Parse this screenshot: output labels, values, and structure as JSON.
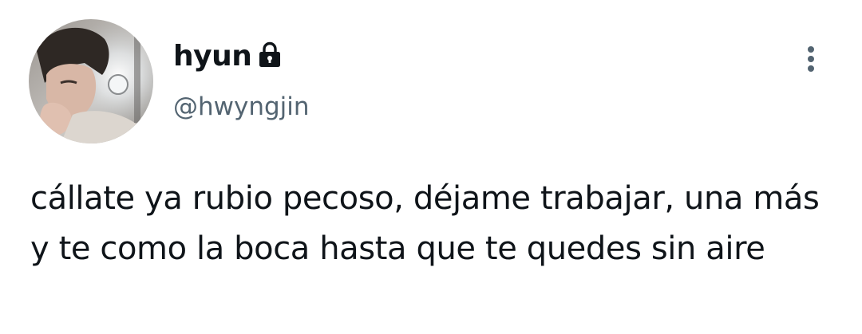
{
  "tweet": {
    "author": {
      "display_name": "hyun",
      "handle": "@hwyngjin",
      "protected_icon": "lock-icon",
      "avatar_icon": "avatar-photo"
    },
    "more_icon": "more-vertical-icon",
    "text": "cállate ya rubio pecoso, déjame trabajar, una más y te como la boca hasta que te quedes sin aire"
  },
  "colors": {
    "text_primary": "#0f1419",
    "text_secondary": "#536471",
    "background": "#ffffff"
  }
}
